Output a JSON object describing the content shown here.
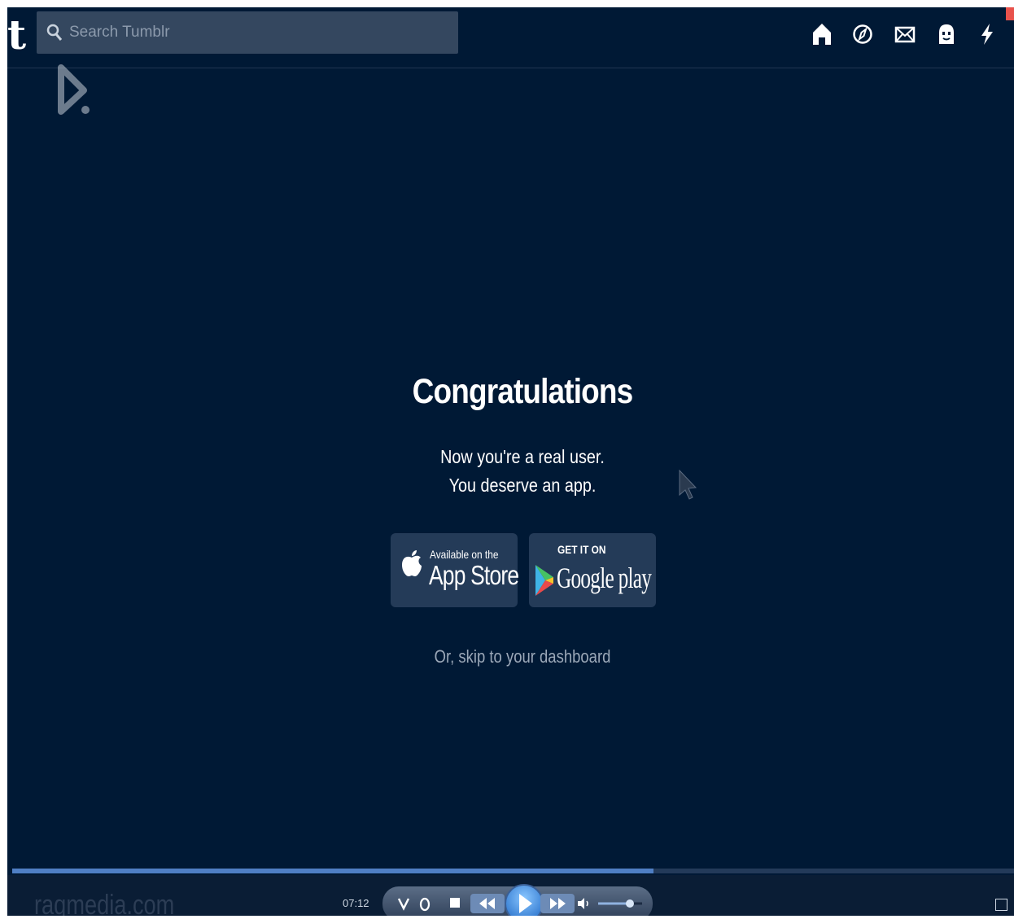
{
  "search": {
    "placeholder": "Search Tumblr"
  },
  "header": {
    "logo_letter": "t",
    "nav_icons": [
      "home-icon",
      "explore-icon",
      "inbox-icon",
      "account-icon",
      "activity-icon"
    ]
  },
  "main": {
    "headline": "Congratulations",
    "subline_1": "Now you're a real user.",
    "subline_2": "You deserve an app.",
    "app_store": {
      "small": "Available on the",
      "big": "App Store"
    },
    "google_play": {
      "small": "GET IT ON",
      "big": "Google play"
    },
    "skip_link": "Or, skip to your dashboard"
  },
  "player": {
    "watermark": "raqmedia.com",
    "timecode": "07:12",
    "progress_fraction": 0.64
  },
  "colors": {
    "background": "#001935",
    "search_bg": "#34475f",
    "button_bg": "#243b58",
    "progress": "#4f7fc4"
  }
}
